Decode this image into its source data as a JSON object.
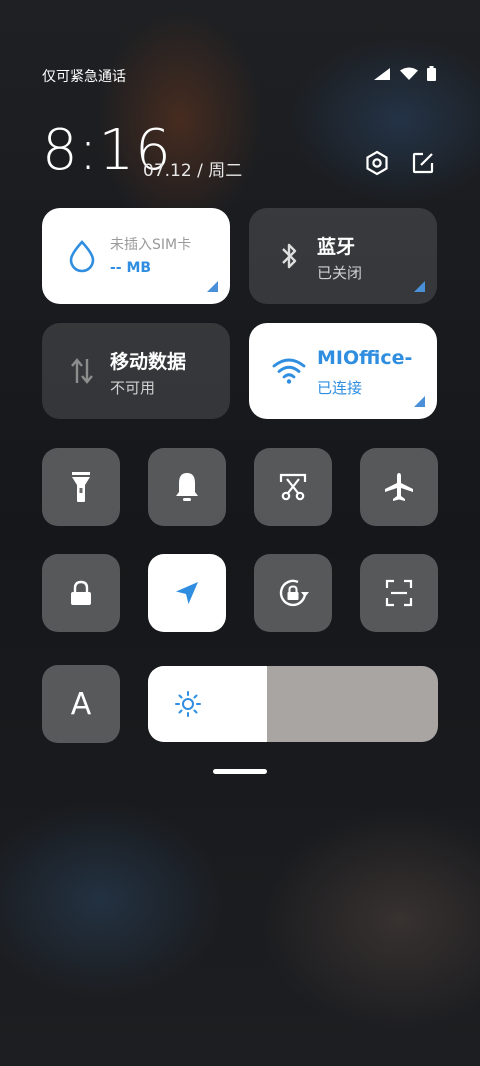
{
  "status_bar": {
    "carrier": "仅可紧急通话",
    "icons": [
      "signal-icon",
      "wifi-icon",
      "battery-icon"
    ]
  },
  "header": {
    "time": "8:16",
    "date": "07.12 / 周二",
    "icons": [
      "settings-icon",
      "edit-icon"
    ]
  },
  "tiles": {
    "data_usage": {
      "title": "未插入SIM卡",
      "value": "-- MB",
      "icon": "water-drop-icon",
      "active": true
    },
    "bluetooth": {
      "title": "蓝牙",
      "status": "已关闭",
      "icon": "bluetooth-icon",
      "active": false
    },
    "mobile_data": {
      "title": "移动数据",
      "status": "不可用",
      "icon": "mobile-data-icon",
      "active": false
    },
    "wifi": {
      "title": "MIOffice-",
      "status": "已连接",
      "icon": "wifi-icon",
      "active": true
    }
  },
  "toggles": [
    {
      "name": "flashlight",
      "icon": "flashlight-icon",
      "active": false
    },
    {
      "name": "mute",
      "icon": "bell-icon",
      "active": false
    },
    {
      "name": "screenshot",
      "icon": "scissors-icon",
      "active": false
    },
    {
      "name": "airplane",
      "icon": "airplane-icon",
      "active": false
    },
    {
      "name": "lock-screen",
      "icon": "lock-icon",
      "active": false
    },
    {
      "name": "location",
      "icon": "location-arrow-icon",
      "active": true
    },
    {
      "name": "rotation-lock",
      "icon": "rotation-lock-icon",
      "active": false
    },
    {
      "name": "scanner",
      "icon": "scan-icon",
      "active": false
    }
  ],
  "auto_brightness": {
    "label": "A"
  },
  "brightness": {
    "level": 0.41,
    "icon": "sun-icon"
  },
  "colors": {
    "accent": "#2f8ee0",
    "tile_active": "#ffffff",
    "tile_inactive": "rgba(255,255,255,0.13)"
  }
}
